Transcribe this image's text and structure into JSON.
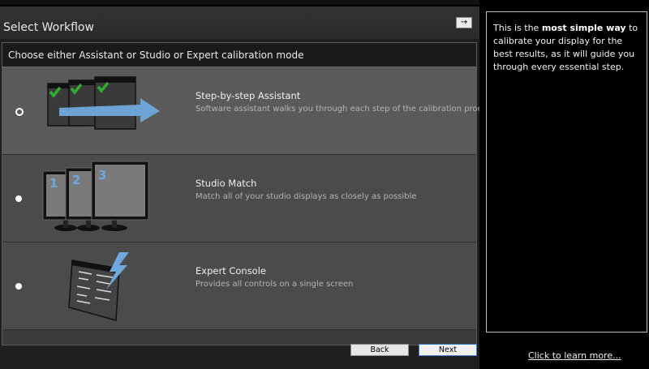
{
  "window": {
    "title": "Select Workflow",
    "arrow_button": "→"
  },
  "panel": {
    "heading": "Choose either Assistant or Studio or Expert calibration mode"
  },
  "options": [
    {
      "title": "Step-by-step Assistant",
      "description": "Software assistant walks you through each step of the calibration process",
      "selected": true,
      "icon": "stacked-windows-checkmarks-arrow-icon"
    },
    {
      "title": "Studio Match",
      "description": "Match all of your studio displays as closely as possible",
      "selected": false,
      "icon": "three-monitors-icon",
      "labels": [
        "1",
        "2",
        "3"
      ]
    },
    {
      "title": "Expert Console",
      "description": "Provides all controls on a single screen",
      "selected": false,
      "icon": "console-window-lightning-icon"
    }
  ],
  "footer": {
    "back_label": "Back",
    "next_label": "Next"
  },
  "side": {
    "text_before": "This is the ",
    "text_bold": "most simple way",
    "text_after": " to calibrate your display for the best results, as it will guide you through every essential step.",
    "learn_more": "Click to learn more..."
  },
  "colors": {
    "accent_blue": "#6fa8dc",
    "check_green": "#2fae2f",
    "next_border": "#3c7fd6"
  }
}
